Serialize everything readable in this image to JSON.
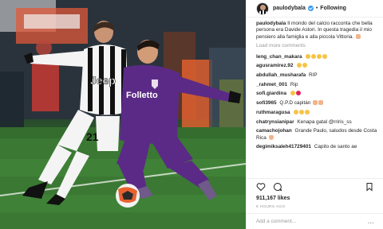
{
  "post": {
    "username": "paulodybala",
    "separator": "•",
    "follow_label": "Following",
    "caption": "Il mondo del calcio racconta che bella persona era Davide Astori. In questa tragedia il mio pensiero alla famiglia e alla piccola Vittoria.",
    "load_more": "Load more comments",
    "likes": "911,167 likes",
    "time": "8 HOURS AGO",
    "add_comment_placeholder": "Add a comment...",
    "more_options": "..."
  },
  "photo": {
    "jersey_sponsor_left": "Jeep",
    "jersey_number_left": "21",
    "jersey_sponsor_right": "Folletto"
  },
  "comments": [
    {
      "user": "leng_chan_makara",
      "text": ""
    },
    {
      "user": "agusramirez.92",
      "text": ""
    },
    {
      "user": "abdullah_musharafa",
      "text": "RIP"
    },
    {
      "user": "_rahmet_001",
      "text": "Rip"
    },
    {
      "user": "sofi.giardina",
      "text": ""
    },
    {
      "user": "sofi3965",
      "text": "Q.P.D capitán"
    },
    {
      "user": "ruthmaragusa",
      "text": ""
    },
    {
      "user": "chatrynsianipar",
      "text": "Kenapa gatal @rriris_ss"
    },
    {
      "user": "camachojohan",
      "text": "Grande Paulo, saludos desde Costa Rica"
    },
    {
      "user": "degimiksaleh41729401",
      "text": "Capito de santo ae"
    }
  ],
  "colors": {
    "verified": "#3897f0",
    "juventus_black": "#111111",
    "fiorentina_purple": "#5b2a86",
    "pitch_green": "#3c7a34"
  }
}
